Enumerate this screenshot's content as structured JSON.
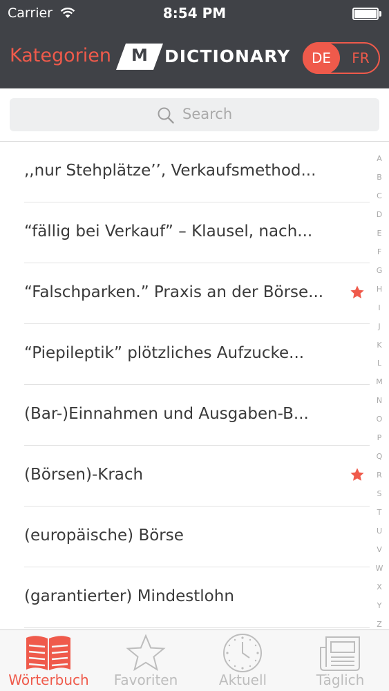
{
  "status": {
    "carrier": "Carrier",
    "time": "8:54 PM"
  },
  "nav": {
    "kategorien": "Kategorien",
    "logo_letter": "M",
    "logo_word": "DICTIONARY",
    "lang_de": "DE",
    "lang_fr": "FR",
    "active_language": "DE"
  },
  "search": {
    "placeholder": "Search"
  },
  "list": [
    {
      "text": ",,nur Stehplätze’’, Verkaufsmethod...",
      "favorite": false
    },
    {
      "text": "“fällig bei Verkauf” – Klausel, nach...",
      "favorite": false
    },
    {
      "text": "“Falschparken.” Praxis an der Börse...",
      "favorite": true
    },
    {
      "text": "“Piepileptik” plötzliches Aufzucke...",
      "favorite": false
    },
    {
      "text": "(Bar-)Einnahmen und Ausgaben-B...",
      "favorite": false
    },
    {
      "text": "(Börsen)-Krach",
      "favorite": true
    },
    {
      "text": "(europäische) Börse",
      "favorite": false
    },
    {
      "text": "(garantierter) Mindestlohn",
      "favorite": false
    }
  ],
  "index_letters": [
    "A",
    "B",
    "C",
    "D",
    "E",
    "F",
    "G",
    "H",
    "I",
    "J",
    "K",
    "L",
    "M",
    "N",
    "O",
    "P",
    "Q",
    "R",
    "S",
    "T",
    "U",
    "V",
    "W",
    "X",
    "Y",
    "Z"
  ],
  "tabs": [
    {
      "label": "Wörterbuch",
      "icon": "book-icon",
      "active": true
    },
    {
      "label": "Favoriten",
      "icon": "star-icon",
      "active": false
    },
    {
      "label": "Aktuell",
      "icon": "clock-icon",
      "active": false
    },
    {
      "label": "Täglich",
      "icon": "newspaper-icon",
      "active": false
    }
  ],
  "colors": {
    "accent": "#ef5a4b",
    "header": "#404247",
    "tab_inactive": "#bdbdbd"
  }
}
